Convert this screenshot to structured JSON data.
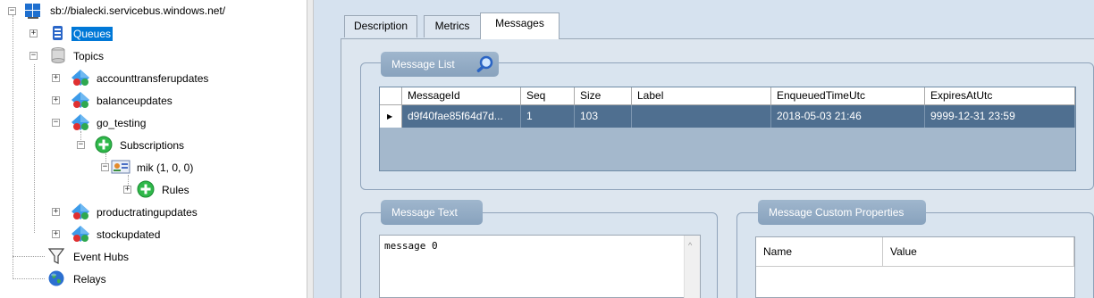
{
  "tree": {
    "root": "sb://bialecki.servicebus.windows.net/",
    "queues": "Queues",
    "topics": "Topics",
    "topic_items": [
      "accounttransferupdates",
      "balanceupdates",
      "go_testing",
      "productratingupdates",
      "stockupdated"
    ],
    "subscriptions": "Subscriptions",
    "subscription": "mik (1, 0, 0)",
    "rules": "Rules",
    "event_hubs": "Event Hubs",
    "relays": "Relays",
    "expand_plus": "+",
    "expand_minus": "−"
  },
  "tabs": [
    "Description",
    "Metrics",
    "Messages"
  ],
  "active_tab": "Messages",
  "message_list": {
    "title": "Message List",
    "columns": [
      "MessageId",
      "Seq",
      "Size",
      "Label",
      "EnqueuedTimeUtc",
      "ExpiresAtUtc"
    ],
    "rows": [
      [
        "d9f40fae85f64d7d...",
        "1",
        "103",
        "",
        "2018-05-03 21:46",
        "9999-12-31 23:59"
      ]
    ],
    "row_marker": "▶"
  },
  "message_text": {
    "title": "Message Text",
    "content": "message 0",
    "scroll_up": "^"
  },
  "custom_properties": {
    "title": "Message Custom Properties",
    "columns": [
      "Name",
      "Value"
    ]
  },
  "colors": {
    "selection": "#0078d7",
    "grid_row": "#4f6f90",
    "group_title": "#94adc6"
  }
}
